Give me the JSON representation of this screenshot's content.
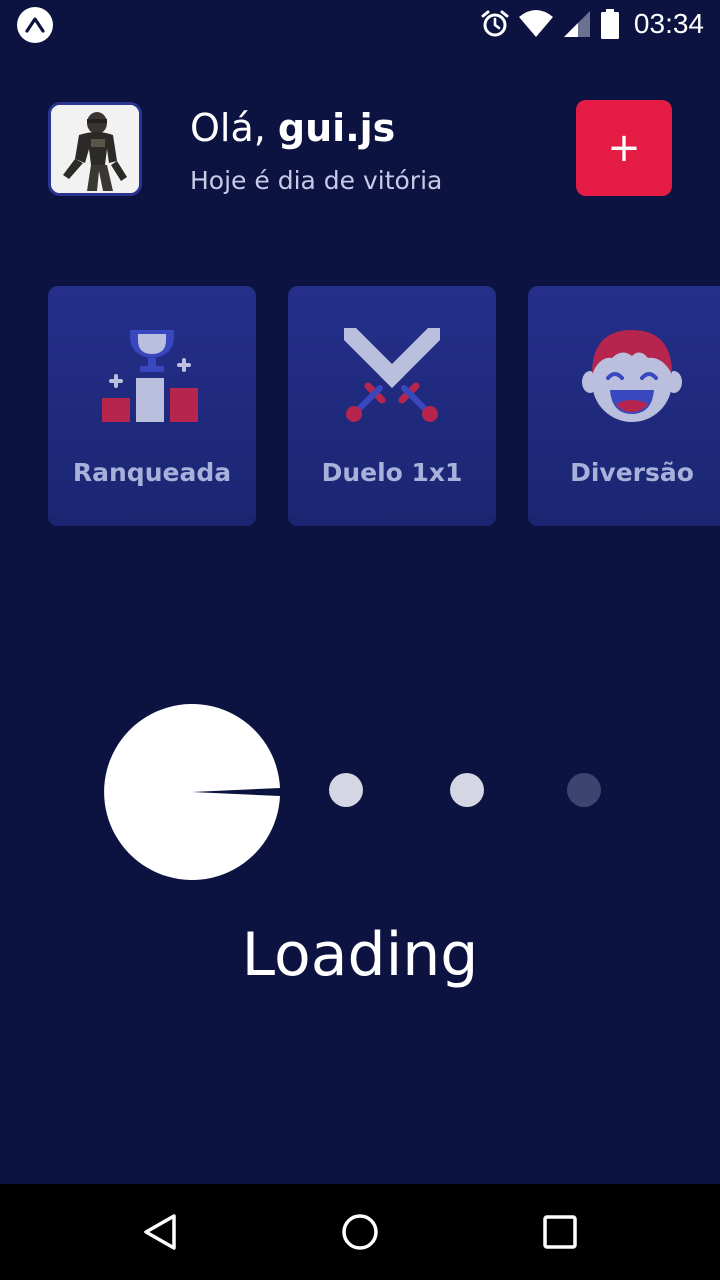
{
  "status_bar": {
    "time": "03:34",
    "icons": [
      "expo-icon",
      "alarm-icon",
      "wifi-icon",
      "cell-signal-icon",
      "battery-icon"
    ]
  },
  "header": {
    "greeting_prefix": "Olá, ",
    "user_name": "gui.js",
    "subtitle": "Hoje é dia de vitória",
    "add_button_label": "+"
  },
  "categories": [
    {
      "label": "Ranqueada",
      "icon": "ranked-trophy-icon"
    },
    {
      "label": "Duelo 1x1",
      "icon": "crossed-swords-icon"
    },
    {
      "label": "Diversão",
      "icon": "laughing-face-icon"
    }
  ],
  "loading": {
    "text": "Loading",
    "icon": "pacman-loader-icon"
  },
  "nav_bar": {
    "icons": [
      "back-icon",
      "home-icon",
      "recent-apps-icon"
    ]
  },
  "colors": {
    "background": "#0d1340",
    "accent": "#e51c44",
    "card_top": "#242f8a",
    "card_label": "#a8b1da"
  }
}
